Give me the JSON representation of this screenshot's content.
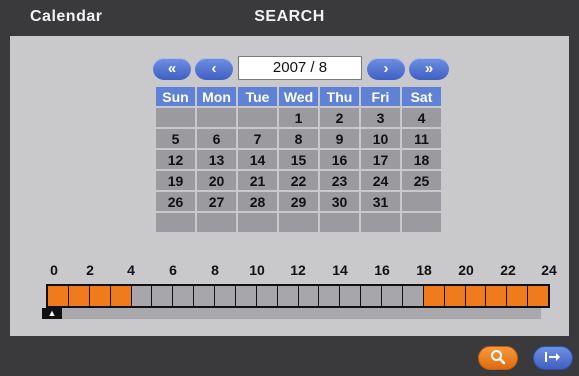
{
  "window": {
    "title": "Calendar",
    "screen": "SEARCH"
  },
  "calendar": {
    "nav": {
      "prev_year": "«",
      "prev_month": "‹",
      "next_month": "›",
      "next_year": "»"
    },
    "month_label": "2007 / 8",
    "weekdays": [
      "Sun",
      "Mon",
      "Tue",
      "Wed",
      "Thu",
      "Fri",
      "Sat"
    ],
    "weeks": [
      [
        "",
        "",
        "",
        "1",
        "2",
        "3",
        "4"
      ],
      [
        "5",
        "6",
        "7",
        "8",
        "9",
        "10",
        "11"
      ],
      [
        "12",
        "13",
        "14",
        "15",
        "16",
        "17",
        "18"
      ],
      [
        "19",
        "20",
        "21",
        "22",
        "23",
        "24",
        "25"
      ],
      [
        "26",
        "27",
        "28",
        "29",
        "30",
        "31",
        ""
      ],
      [
        "",
        "",
        "",
        "",
        "",
        "",
        ""
      ]
    ]
  },
  "timeline": {
    "tick_labels": [
      "0",
      "2",
      "4",
      "6",
      "8",
      "10",
      "12",
      "14",
      "16",
      "18",
      "20",
      "22",
      "24"
    ],
    "hours_recorded": [
      1,
      1,
      1,
      1,
      0,
      0,
      0,
      0,
      0,
      0,
      0,
      0,
      0,
      0,
      0,
      0,
      0,
      0,
      1,
      1,
      1,
      1,
      1,
      1
    ],
    "recorded_color": "#f07b1c",
    "empty_color": "#a7a7ab",
    "scroll_icon": "caret-up-icon"
  },
  "buttons": {
    "search_icon": "magnifier-icon",
    "exit_icon": "exit-arrow-icon"
  }
}
